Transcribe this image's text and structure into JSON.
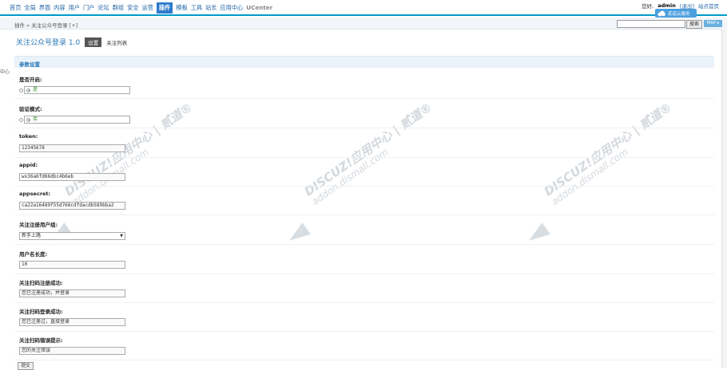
{
  "nav": {
    "items": [
      "首页",
      "全局",
      "界面",
      "内容",
      "用户",
      "门户",
      "论坛",
      "群组",
      "安全",
      "运营",
      "插件",
      "模板",
      "工具",
      "站长",
      "应用中心",
      "UCenter"
    ],
    "active_index": 10
  },
  "user": {
    "greeting": "您好,",
    "name": "admin",
    "logout": "[退出]",
    "home": "站点首页",
    "cloud_label": "贰道云服务"
  },
  "breadcrumb": "插件 » 关注公众号登录 [+]",
  "search": {
    "button": "搜索",
    "map": "MAP ▸"
  },
  "left_fragment": "中心",
  "plugin": {
    "title": "关注公众号登录 1.0",
    "tab_active": "设置",
    "tab_other": "关注列表"
  },
  "section_title": "参数设置",
  "fields": {
    "enabled": {
      "label": "是否开启:",
      "opt_yes": "是",
      "opt_no": "否",
      "selected": "yes"
    },
    "verify": {
      "label": "验证模式:",
      "opt_yes": "是",
      "opt_no": "否",
      "selected": "no"
    },
    "token": {
      "label": "token:",
      "value": "12345678"
    },
    "appid": {
      "label": "appid:",
      "value": "wx36a6fd66dbc4b6eb"
    },
    "appsecret": {
      "label": "appsecret:",
      "value": "ca22a16489f55d768cdfdacdb589bba2"
    },
    "group": {
      "label": "关注注册用户组:",
      "value": "新手上路"
    },
    "namelen": {
      "label": "用户名长度:",
      "value": "10"
    },
    "reg_ok": {
      "label": "关注扫码注册成功:",
      "value": "您已注册成功，并登录"
    },
    "login_ok": {
      "label": "关注扫码登录成功:",
      "value": "您已注册过，直接登录"
    },
    "error": {
      "label": "关注扫码错误提示:",
      "value": "您的关注错误"
    }
  },
  "submit": "提交",
  "watermark": {
    "line1": "DISCUZ!应用中心 | 贰道®",
    "line2": "addon.dismall.com"
  }
}
